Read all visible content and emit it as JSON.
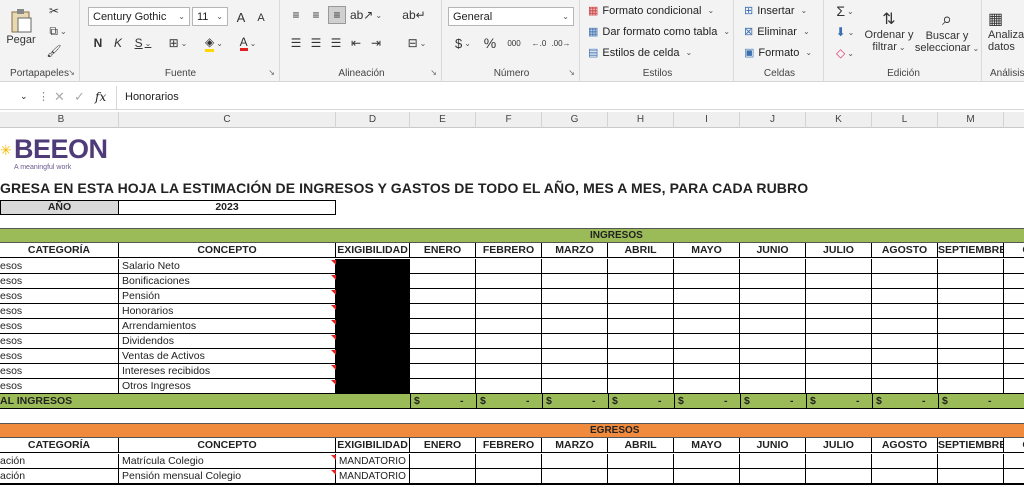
{
  "ribbon": {
    "clipboard": {
      "paste": "Pegar",
      "label": "Portapapeles"
    },
    "font": {
      "name": "Century Gothic",
      "size": "11",
      "bold": "N",
      "italic": "K",
      "underline": "S",
      "label": "Fuente",
      "grow": "A",
      "shrink": "A",
      "fontcolor": "A"
    },
    "alignment": {
      "label": "Alineación"
    },
    "number": {
      "format": "General",
      "label": "Número",
      "currency": "$",
      "percent": "%",
      "thousands": "000"
    },
    "styles": {
      "conditional": "Formato condicional",
      "table": "Dar formato como tabla",
      "cell_styles": "Estilos de celda",
      "label": "Estilos"
    },
    "cells": {
      "insert": "Insertar",
      "delete": "Eliminar",
      "format": "Formato",
      "label": "Celdas"
    },
    "editing": {
      "sort1": "Ordenar y",
      "sort2": "filtrar",
      "find1": "Buscar y",
      "find2": "seleccionar",
      "label": "Edición"
    },
    "analysis": {
      "line1": "Analiza",
      "line2": "datos",
      "label": "Análisis"
    }
  },
  "formula_bar": {
    "fx": "fx",
    "value": "Honorarios"
  },
  "columns": [
    "B",
    "C",
    "D",
    "E",
    "F",
    "G",
    "H",
    "I",
    "J",
    "K",
    "L",
    "M"
  ],
  "sheet": {
    "logo": "BEEON",
    "tagline": "A meaningful work",
    "headline": "GRESA EN ESTA HOJA LA ESTIMACIÓN DE INGRESOS Y GASTOS DE TODO EL AÑO, MES A MES, PARA CADA RUBRO",
    "year_label": "AÑO",
    "year": "2023",
    "ingresos_title": "INGRESOS",
    "egresos_title": "EGRESOS",
    "headers": [
      "CATEGORÍA",
      "CONCEPTO",
      "EXIGIBILIDAD",
      "ENERO",
      "FEBRERO",
      "MARZO",
      "ABRIL",
      "MAYO",
      "JUNIO",
      "JULIO",
      "AGOSTO",
      "SEPTIEMBRE",
      "O"
    ],
    "income_rows": [
      {
        "cat": "esos",
        "concept": "Salario Neto"
      },
      {
        "cat": "esos",
        "concept": "Bonificaciones"
      },
      {
        "cat": "esos",
        "concept": "Pensión"
      },
      {
        "cat": "esos",
        "concept": "Honorarios"
      },
      {
        "cat": "esos",
        "concept": "Arrendamientos"
      },
      {
        "cat": "esos",
        "concept": "Dividendos"
      },
      {
        "cat": "esos",
        "concept": "Ventas de Activos"
      },
      {
        "cat": "esos",
        "concept": "Intereses recibidos"
      },
      {
        "cat": "esos",
        "concept": "Otros Ingresos"
      }
    ],
    "total_label": "AL INGRESOS",
    "total_values": [
      "$",
      "-",
      "$",
      "-",
      "$",
      "-",
      "$",
      "-",
      "$",
      "-",
      "$",
      "-",
      "$",
      "-",
      "$",
      "-",
      "$",
      "-"
    ],
    "expense_rows": [
      {
        "cat": "ación",
        "concept": "Matrícula Colegio",
        "exig": "MANDATORIO"
      },
      {
        "cat": "ación",
        "concept": "Pensión mensual Colegio",
        "exig": "MANDATORIO"
      }
    ]
  },
  "colors": {
    "green": "#9bbb59",
    "orange": "#f08a3c",
    "logo": "#4f3b78"
  }
}
